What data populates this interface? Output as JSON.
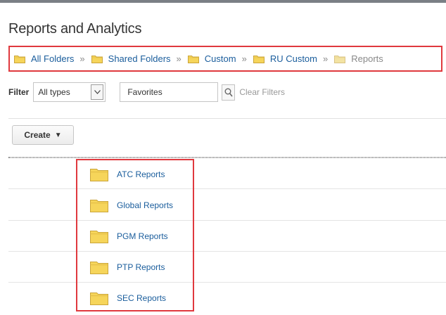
{
  "page": {
    "title": "Reports and Analytics"
  },
  "breadcrumb": {
    "items": [
      "All Folders",
      "Shared Folders",
      "Custom",
      "RU Custom",
      "Reports"
    ],
    "separator": "»"
  },
  "filter": {
    "label": "Filter",
    "type_value": "All types",
    "search_value": "Favorites",
    "clear_label": "Clear Filters"
  },
  "toolbar": {
    "create_label": "Create",
    "create_arrow": "▼"
  },
  "folders": [
    "ATC Reports",
    "Global Reports",
    "PGM Reports",
    "PTP Reports",
    "SEC Reports"
  ],
  "colors": {
    "link": "#1a5d9c",
    "highlight": "#e0393e",
    "folder_yellow": "#f6d55a"
  },
  "icons": {
    "folder": "folder-icon",
    "search": "search-icon",
    "dropdown": "chevron-down-icon"
  }
}
